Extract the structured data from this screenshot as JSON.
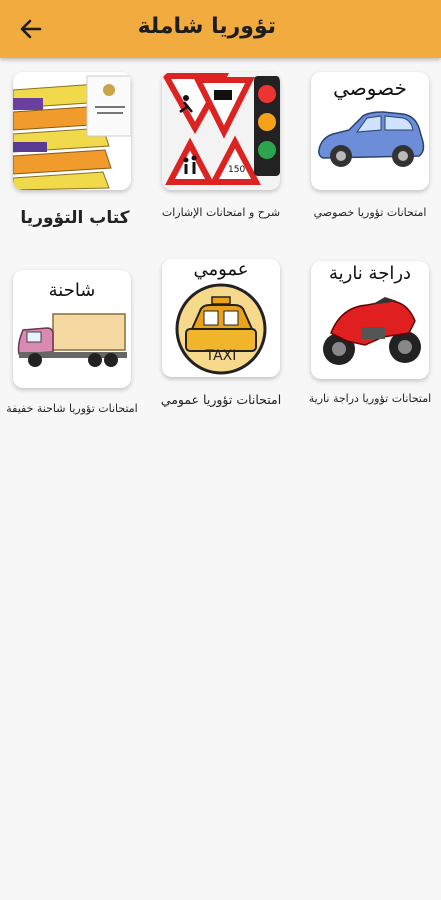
{
  "appbar": {
    "title": "تؤوريا شاملة",
    "back_icon": "arrow-left-icon",
    "color": "#f2ab3f"
  },
  "tiles": [
    {
      "id": "private",
      "label": "خصوصي",
      "caption": "امتحانات تؤوريا خصوصي",
      "icon": "car-icon"
    },
    {
      "id": "signs",
      "caption": "شرح و امتحانات الإشارات",
      "icon": "traffic-signs-icon"
    },
    {
      "id": "book",
      "caption": "كتاب التؤوريا",
      "icon": "books-icon"
    },
    {
      "id": "motorcycle",
      "label": "دراجة نارية",
      "caption": "امتحانات تؤوريا دراجة نارية",
      "icon": "motorcycle-icon"
    },
    {
      "id": "public",
      "label": "عمومي",
      "caption": "امتحانات تؤوريا عمومي",
      "icon": "taxi-icon",
      "taxi_text": "TAXI"
    },
    {
      "id": "truck",
      "label": "شاحنة",
      "caption": "امتحانات تؤوريا شاحنة خفيفة",
      "icon": "truck-icon"
    }
  ]
}
